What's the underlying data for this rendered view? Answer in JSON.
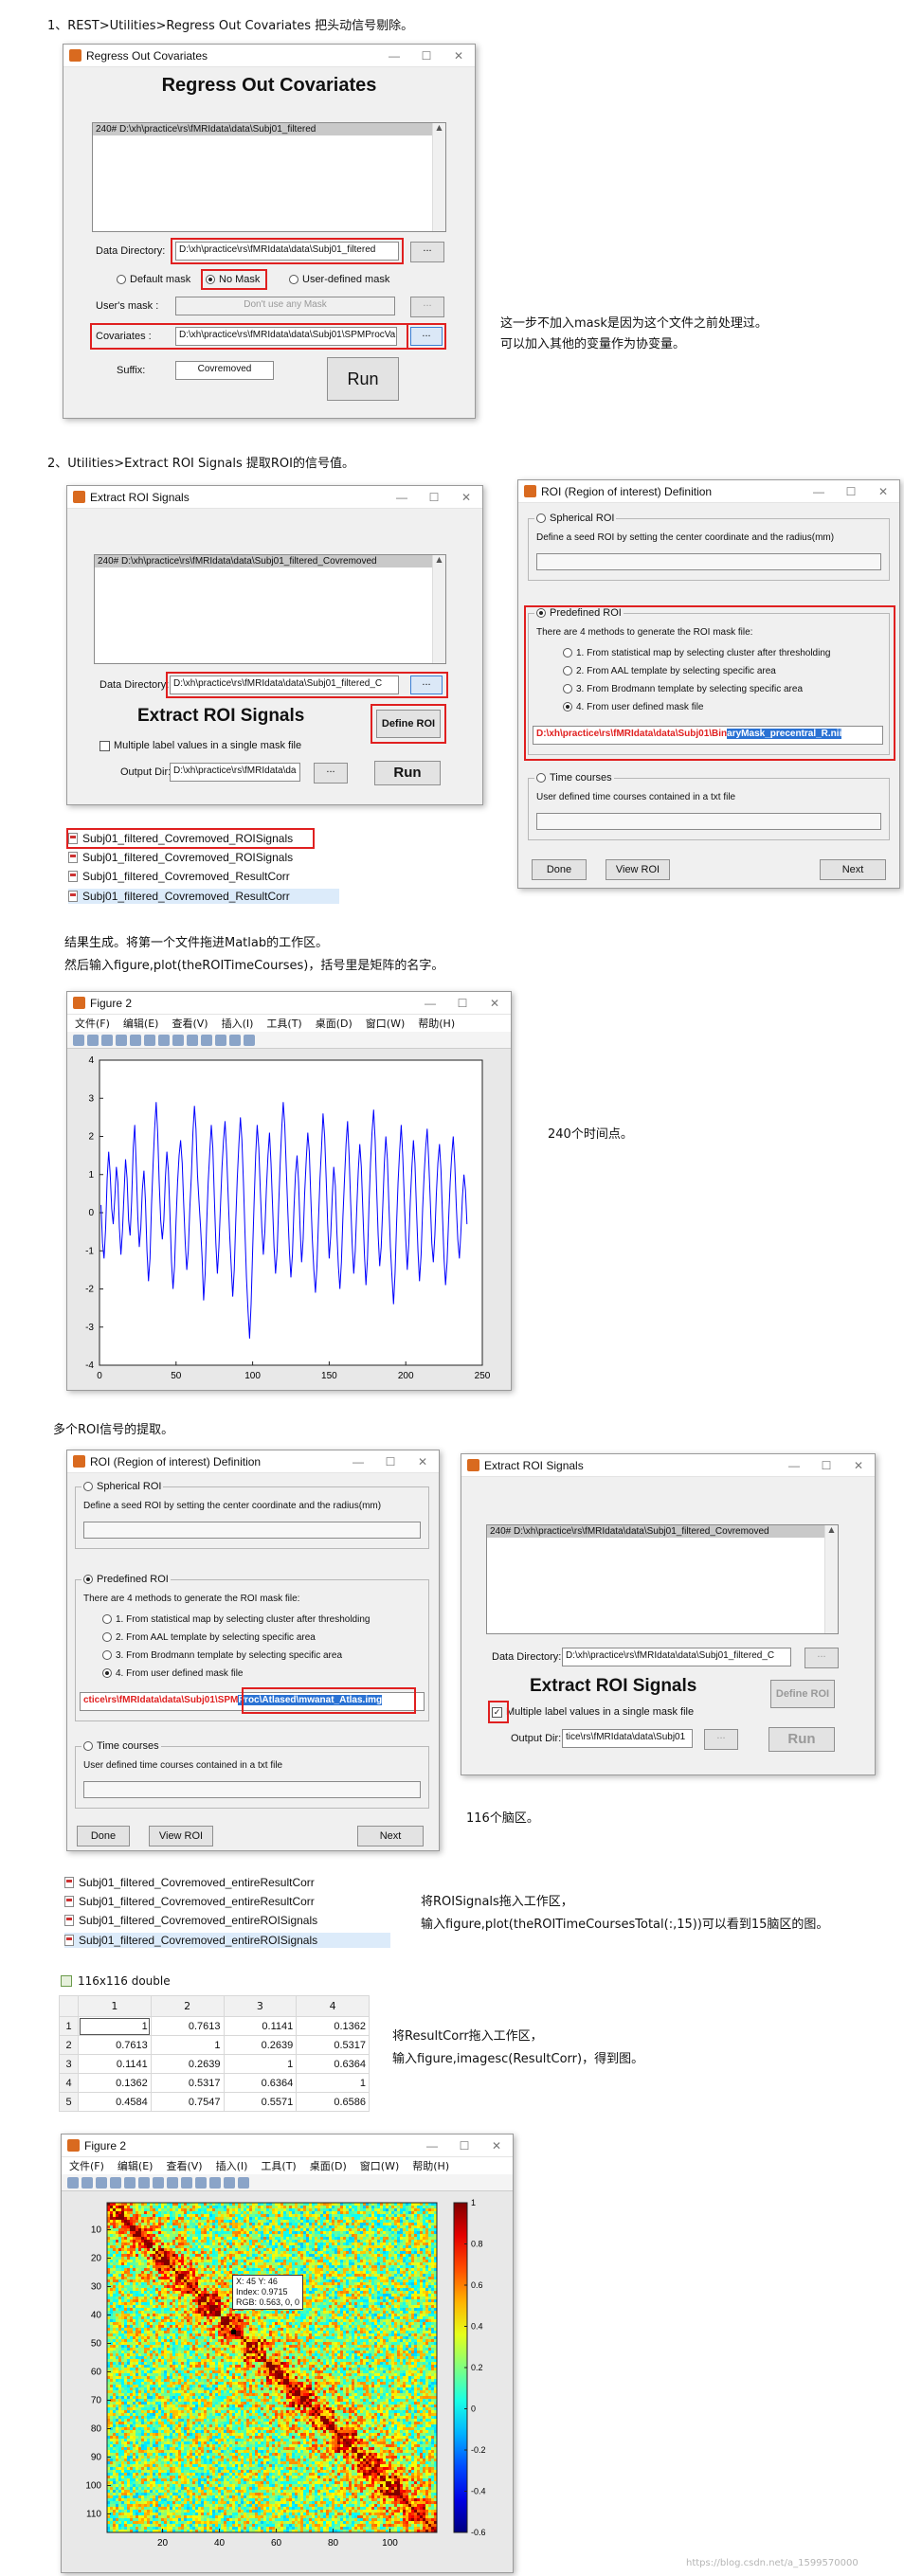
{
  "text": {
    "step1": "1、REST>Utilities>Regress Out Covariates  把头动信号剔除。",
    "note1a": "这一步不加入mask是因为这个文件之前处理过。",
    "note1b": "可以加入其他的变量作为协变量。",
    "step2": "2、Utilities>Extract ROI Signals 提取ROI的信号值。",
    "res1": "结果生成。将第一个文件拖进Matlab的工作区。",
    "res2": "然后输入figure,plot(theROITimeCourses)，括号里是矩阵的名字。",
    "timepoints": "240个时间点。",
    "multi": "多个ROI信号的提取。",
    "brain": "116个脑区。",
    "drag1": "将ROISignals拖入工作区，",
    "drag2": "输入figure,plot(theROITimeCoursesTotal(:,15))可以看到15脑区的图。",
    "corr1": "将ResultCorr拖入工作区，",
    "corr2": "输入figure,imagesc(ResultCorr)，得到图。",
    "watermark": "https://blog.csdn.net/a_1599570000"
  },
  "win_buttons": {
    "min": "—",
    "max": "☐",
    "close": "✕"
  },
  "regress": {
    "title": "Regress Out Covariates",
    "heading": "Regress Out Covariates",
    "list_item": "240# D:\\xh\\practice\\rs\\fMRIdata\\data\\Subj01_filtered",
    "data_dir_label": "Data Directory:",
    "data_dir": "D:\\xh\\practice\\rs\\fMRIdata\\data\\Subj01_filtered",
    "browse": "...",
    "opt_default": "Default mask",
    "opt_nomask": "No Mask",
    "opt_user": "User-defined mask",
    "user_mask_label": "User's mask :",
    "user_mask_placeholder": "Don't use any Mask",
    "cov_label": "Covariates :",
    "cov_value": "D:\\xh\\practice\\rs\\fMRIdata\\data\\Subj01\\SPMProcVa",
    "suffix_label": "Suffix:",
    "suffix_value": "Covremoved",
    "run": "Run"
  },
  "extract1": {
    "title": "Extract ROI Signals",
    "list_item": "240# D:\\xh\\practice\\rs\\fMRIdata\\data\\Subj01_filtered_Covremoved",
    "data_dir_label": "Data Directory:",
    "data_dir": "D:\\xh\\practice\\rs\\fMRIdata\\data\\Subj01_filtered_C",
    "browse": "...",
    "heading": "Extract ROI Signals",
    "define": "Define ROI",
    "multi_label": "Multiple label values in a single mask file",
    "out_label": "Output Dir:",
    "out_value": "D:\\xh\\practice\\rs\\fMRIdata\\da",
    "run": "Run"
  },
  "roi1": {
    "title": "ROI (Region of interest) Definition",
    "spherical": "Spherical ROI",
    "spherical_desc": "Define a seed ROI by setting the center coordinate and the radius(mm)",
    "predefined": "Predefined ROI",
    "pre_desc": "There are 4 methods to generate the ROI mask file:",
    "m1": "1. From statistical map by selecting cluster after thresholding",
    "m2": "2. From AAL template by selecting specific area",
    "m3": "3. From Brodmann template by selecting specific area",
    "m4": "4. From user defined mask file",
    "path_a": "D:\\xh\\practice\\rs\\fMRIdata\\data\\Subj01\\Bin",
    "path_b": "aryMask_precentral_R.nii",
    "time": "Time courses",
    "time_desc": "User defined time courses contained in a txt file",
    "done": "Done",
    "view": "View ROI",
    "next": "Next"
  },
  "files1": [
    "Subj01_filtered_Covremoved_ROISignals",
    "Subj01_filtered_Covremoved_ROISignals",
    "Subj01_filtered_Covremoved_ResultCorr",
    "Subj01_filtered_Covremoved_ResultCorr"
  ],
  "fig1": {
    "title": "Figure 2",
    "menu": [
      "文件(F)",
      "编辑(E)",
      "查看(V)",
      "插入(I)",
      "工具(T)",
      "桌面(D)",
      "窗口(W)",
      "帮助(H)"
    ]
  },
  "roi2": {
    "title": "ROI (Region of interest) Definition",
    "spherical": "Spherical ROI",
    "spherical_desc": "Define a seed ROI by setting the center coordinate and the radius(mm)",
    "predefined": "Predefined ROI",
    "pre_desc": "There are 4 methods to generate the ROI mask file:",
    "m1": "1. From statistical map by selecting cluster after thresholding",
    "m2": "2. From AAL template by selecting specific area",
    "m3": "3. From Brodmann template by selecting specific area",
    "m4": "4. From user defined mask file",
    "path_a": "ctice\\rs\\fMRIdata\\data\\Subj01\\SPM",
    "path_b": "Proc\\Atlased\\mwanat_Atlas.img",
    "time": "Time courses",
    "time_desc": "User defined time courses contained in a txt file",
    "done": "Done",
    "view": "View ROI",
    "next": "Next"
  },
  "extract2": {
    "title": "Extract ROI Signals",
    "list_item": "240# D:\\xh\\practice\\rs\\fMRIdata\\data\\Subj01_filtered_Covremoved",
    "data_dir_label": "Data Directory:",
    "data_dir": "D:\\xh\\practice\\rs\\fMRIdata\\data\\Subj01_filtered_C",
    "browse": "...",
    "heading": "Extract ROI Signals",
    "define": "Define ROI",
    "multi_label": "Multiple label values in a single mask file",
    "out_label": "Output Dir:",
    "out_value": "tice\\rs\\fMRIdata\\data\\Subj01",
    "run": "Run"
  },
  "files2": [
    "Subj01_filtered_Covremoved_entireResultCorr",
    "Subj01_filtered_Covremoved_entireResultCorr",
    "Subj01_filtered_Covremoved_entireROISignals",
    "Subj01_filtered_Covremoved_entireROISignals"
  ],
  "matrix": {
    "title": "116x116 double",
    "cols": [
      "1",
      "2",
      "3",
      "4"
    ],
    "rows": [
      {
        "r": "1",
        "v": [
          "1",
          "0.7613",
          "0.1141",
          "0.1362"
        ]
      },
      {
        "r": "2",
        "v": [
          "0.7613",
          "1",
          "0.2639",
          "0.5317"
        ]
      },
      {
        "r": "3",
        "v": [
          "0.1141",
          "0.2639",
          "1",
          "0.6364"
        ]
      },
      {
        "r": "4",
        "v": [
          "0.1362",
          "0.5317",
          "0.6364",
          "1"
        ]
      },
      {
        "r": "5",
        "v": [
          "0.4584",
          "0.7547",
          "0.5571",
          "0.6586"
        ]
      }
    ]
  },
  "fig2": {
    "title": "Figure 2",
    "menu": [
      "文件(F)",
      "编辑(E)",
      "查看(V)",
      "插入(I)",
      "工具(T)",
      "桌面(D)",
      "窗口(W)",
      "帮助(H)"
    ],
    "tip1": "X: 45 Y: 46",
    "tip2": "Index: 0.9715",
    "tip3": "RGB: 0.563, 0, 0"
  },
  "chart_data": [
    {
      "type": "line",
      "title": "",
      "xlim": [
        0,
        250
      ],
      "ylim": [
        -4,
        4
      ],
      "xticks": [
        0,
        50,
        100,
        150,
        200,
        250
      ],
      "yticks": [
        4,
        3,
        2,
        1,
        0,
        -1,
        -2,
        -3,
        -4
      ],
      "x_start": 1,
      "y": [
        0.2,
        -0.8,
        -1.2,
        -0.4,
        0.9,
        1.6,
        1.0,
        0.1,
        -0.3,
        0.4,
        1.2,
        0.8,
        -0.4,
        -1.1,
        -0.5,
        0.5,
        1.4,
        0.9,
        -0.2,
        -0.6,
        0.3,
        1.7,
        2.3,
        1.2,
        -0.1,
        -0.9,
        -0.4,
        0.6,
        1.1,
        0.3,
        -1.0,
        -1.8,
        -1.2,
        0.2,
        1.3,
        2.2,
        2.9,
        2.1,
        0.8,
        -0.2,
        -0.7,
        -0.2,
        0.9,
        1.6,
        1.1,
        0.0,
        -1.3,
        -2.0,
        -1.4,
        -0.2,
        0.8,
        1.5,
        1.9,
        1.3,
        0.2,
        -0.8,
        -1.5,
        -1.0,
        0.1,
        1.0,
        2.1,
        2.8,
        2.2,
        1.0,
        0.3,
        -0.4,
        -1.2,
        -2.3,
        -1.6,
        -0.3,
        0.8,
        1.6,
        2.3,
        1.7,
        0.4,
        -0.8,
        -1.6,
        -0.9,
        0.2,
        1.2,
        1.9,
        2.4,
        1.6,
        0.5,
        -0.6,
        -1.4,
        -2.2,
        -1.5,
        -0.2,
        0.9,
        1.8,
        2.5,
        1.9,
        0.8,
        -0.5,
        -1.7,
        -2.6,
        -3.3,
        -2.4,
        -1.0,
        0.3,
        1.5,
        2.3,
        1.7,
        0.6,
        -0.4,
        -1.1,
        -0.5,
        0.6,
        1.5,
        2.1,
        1.3,
        0.2,
        -0.9,
        -1.6,
        -1.0,
        0.2,
        1.3,
        2.2,
        2.9,
        2.3,
        1.1,
        0.0,
        -1.0,
        -1.7,
        -1.1,
        0.1,
        1.0,
        1.5,
        0.8,
        -0.4,
        -1.3,
        -0.7,
        0.5,
        1.4,
        2.1,
        1.6,
        0.4,
        -0.7,
        -1.5,
        -2.1,
        -1.4,
        -0.2,
        0.9,
        1.7,
        2.6,
        2.0,
        0.9,
        -0.3,
        -1.2,
        -0.6,
        0.4,
        1.2,
        0.7,
        -0.5,
        -1.4,
        -2.0,
        -1.3,
        -0.1,
        0.9,
        1.8,
        2.4,
        1.5,
        0.3,
        -0.8,
        -1.6,
        -1.0,
        0.1,
        1.1,
        1.8,
        1.2,
        0.0,
        -1.1,
        -1.9,
        -1.2,
        0.2,
        1.3,
        2.1,
        2.7,
        1.9,
        0.6,
        -0.6,
        -1.4,
        -0.9,
        0.2,
        1.3,
        2.0,
        1.4,
        0.2,
        -0.9,
        -1.7,
        -2.4,
        -1.6,
        -0.3,
        0.8,
        1.6,
        2.3,
        1.5,
        0.4,
        -0.7,
        -1.5,
        -0.8,
        0.3,
        1.2,
        1.9,
        1.3,
        0.1,
        -1.0,
        -1.8,
        -1.1,
        0.1,
        1.0,
        1.7,
        2.2,
        1.4,
        0.3,
        -0.8,
        -1.3,
        -0.6,
        0.5,
        1.3,
        1.8,
        1.1,
        -0.1,
        -1.2,
        -1.9,
        -1.3,
        -0.2,
        0.8,
        1.5,
        2.0,
        1.3,
        0.2,
        -0.7,
        -1.2,
        -0.5,
        0.4,
        1.0,
        0.6,
        -0.3
      ]
    },
    {
      "type": "heatmap",
      "title": "",
      "size": 116,
      "xlim": [
        0.5,
        116.5
      ],
      "ylim": [
        0.5,
        116.5
      ],
      "xticks": [
        20,
        40,
        60,
        80,
        100
      ],
      "yticks": [
        10,
        20,
        30,
        40,
        50,
        60,
        70,
        80,
        90,
        100,
        110
      ],
      "clim": [
        -0.6,
        1
      ],
      "colorbar_ticks": [
        1,
        0.8,
        0.6,
        0.4,
        0.2,
        0,
        -0.2,
        -0.4,
        -0.6
      ],
      "colormap": "jet"
    }
  ]
}
